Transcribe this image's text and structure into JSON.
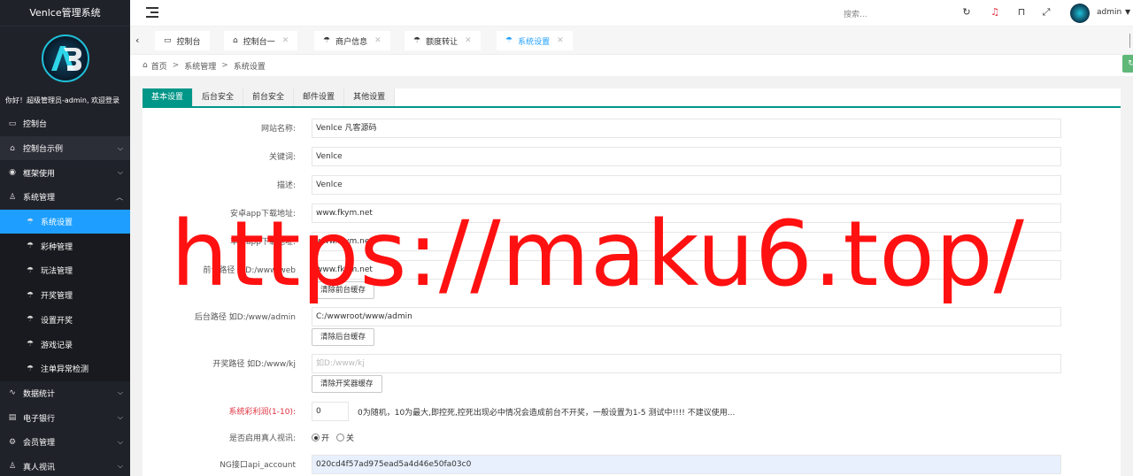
{
  "sidebar": {
    "title": "Venlce管理系统",
    "welcome": "你好！超级管理员-admin, 欢迎登录",
    "items": [
      {
        "label": "控制台",
        "icon": "monitor-icon"
      },
      {
        "label": "控制台示例",
        "icon": "home-icon",
        "has_arrow": true
      },
      {
        "label": "框架使用",
        "icon": "badge-icon",
        "has_arrow": true
      },
      {
        "label": "系统管理",
        "icon": "user-icon",
        "has_arrow": true,
        "open": true
      }
    ],
    "sub_items": [
      {
        "label": "系统设置",
        "active": true
      },
      {
        "label": "彩种管理"
      },
      {
        "label": "玩法管理"
      },
      {
        "label": "开奖管理"
      },
      {
        "label": "设置开奖"
      },
      {
        "label": "游戏记录"
      },
      {
        "label": "注单异常检测"
      }
    ],
    "items_after": [
      {
        "label": "数据统计",
        "icon": "chart-icon",
        "has_arrow": true
      },
      {
        "label": "电子银行",
        "icon": "bank-icon",
        "has_arrow": true
      },
      {
        "label": "会员管理",
        "icon": "gear-icon",
        "has_arrow": true
      },
      {
        "label": "真人视讯",
        "icon": "user-icon",
        "has_arrow": true
      }
    ]
  },
  "header": {
    "search_placeholder": "搜索...",
    "username": "admin"
  },
  "tabs": [
    {
      "label": "控制台",
      "icon": "monitor-icon",
      "closable": false
    },
    {
      "label": "控制台一",
      "icon": "home-icon",
      "closable": true
    },
    {
      "label": "商户信息",
      "icon": "umbrella-icon",
      "closable": true
    },
    {
      "label": "额度转让",
      "icon": "umbrella-icon",
      "closable": true
    },
    {
      "label": "系统设置",
      "icon": "umbrella-icon",
      "closable": true,
      "active": true
    }
  ],
  "breadcrumb": [
    "首页",
    "系统管理",
    "系统设置"
  ],
  "config_tabs": [
    "基本设置",
    "后台安全",
    "前台安全",
    "邮件设置",
    "其他设置"
  ],
  "form": {
    "site_name": {
      "label": "网站名称:",
      "value": "Venlce 凡客源码"
    },
    "keywords": {
      "label": "关键词:",
      "value": "Venlce"
    },
    "description": {
      "label": "描述:",
      "value": "Venlce"
    },
    "android_url": {
      "label": "安卓app下载地址:",
      "value": "www.fkym.net"
    },
    "ios_url": {
      "label": "苹果app下载地址:",
      "value": "www.fkym.net"
    },
    "front_path": {
      "label": "前台路径 如D:/www/web",
      "value": "www.fkym.net",
      "button": "清除前台缓存"
    },
    "admin_path": {
      "label": "后台路径 如D:/www/admin",
      "value": "C:/wwwroot/www/admin",
      "button": "清除后台缓存"
    },
    "lottery_path": {
      "label": "开奖路径 如D:/www/kj",
      "placeholder": "如D:/www/kj",
      "button": "清除开奖器缓存"
    },
    "profit": {
      "label": "系统彩利润(1-10):",
      "value": "0",
      "tip": "0为随机，10为最大,即控死,控死出现必中情况会造成前台不开奖，一般设置为1-5 测试中!!!! 不建议使用..."
    },
    "live_video": {
      "label": "是否启用真人视讯:",
      "options": [
        "开",
        "关"
      ],
      "selected": "开"
    },
    "ng_account": {
      "label": "NG接口api_account",
      "value": "020cd4f57ad975ead5a4d46e50fa03c0"
    }
  },
  "watermark": "https://maku6.top/",
  "colors": {
    "sidebar_bg": "#20222a",
    "active_blue": "#1e9fff",
    "teal": "#009688",
    "watermark_red": "#ff1111"
  }
}
